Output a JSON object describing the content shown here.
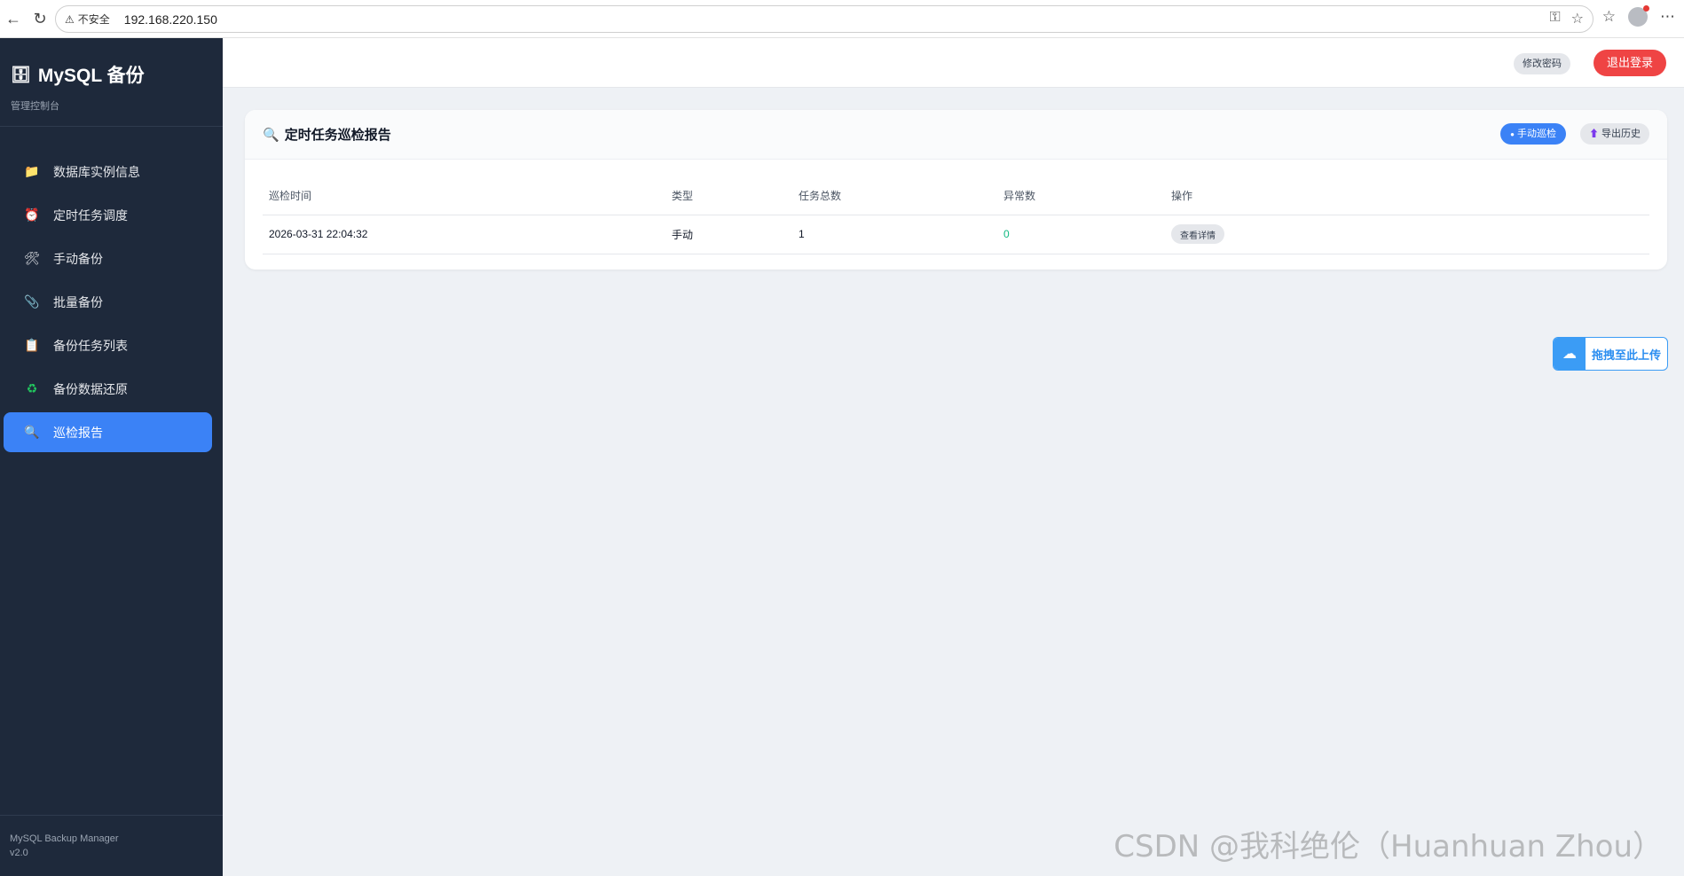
{
  "browser": {
    "back_icon": "←",
    "reload_icon": "↻",
    "insecure_label": "不安全",
    "url": "192.168.220.150"
  },
  "sidebar": {
    "brand_title": "MySQL 备份",
    "brand_subtitle": "管理控制台",
    "items": [
      {
        "label": "数据库实例信息",
        "icon": "📁"
      },
      {
        "label": "定时任务调度",
        "icon": "⏰"
      },
      {
        "label": "手动备份",
        "icon": "🛠"
      },
      {
        "label": "批量备份",
        "icon": "📎"
      },
      {
        "label": "备份任务列表",
        "icon": "📋"
      },
      {
        "label": "备份数据还原",
        "icon": "♻"
      },
      {
        "label": "巡检报告",
        "icon": "🔍",
        "active": true
      }
    ],
    "footer_name": "MySQL Backup Manager",
    "footer_version": "v2.0"
  },
  "topbar": {
    "change_password_label": "修改密码",
    "logout_label": "退出登录"
  },
  "report": {
    "title": "定时任务巡检报告",
    "manual_check_label": "手动巡检",
    "export_history_label": "导出历史",
    "columns": [
      "巡检时间",
      "类型",
      "任务总数",
      "异常数",
      "操作"
    ],
    "rows": [
      {
        "time": "2026-03-31 22:04:32",
        "type": "手动",
        "total": "1",
        "errors": "0",
        "action": "查看详情"
      }
    ]
  },
  "upload_widget": {
    "label": "拖拽至此上传"
  },
  "watermark": "CSDN @我科绝伦（Huanhuan Zhou）",
  "colors": {
    "sidebar_bg": "#1e293b",
    "accent": "#3b82f6",
    "danger": "#ef4444",
    "success": "#10b981"
  }
}
